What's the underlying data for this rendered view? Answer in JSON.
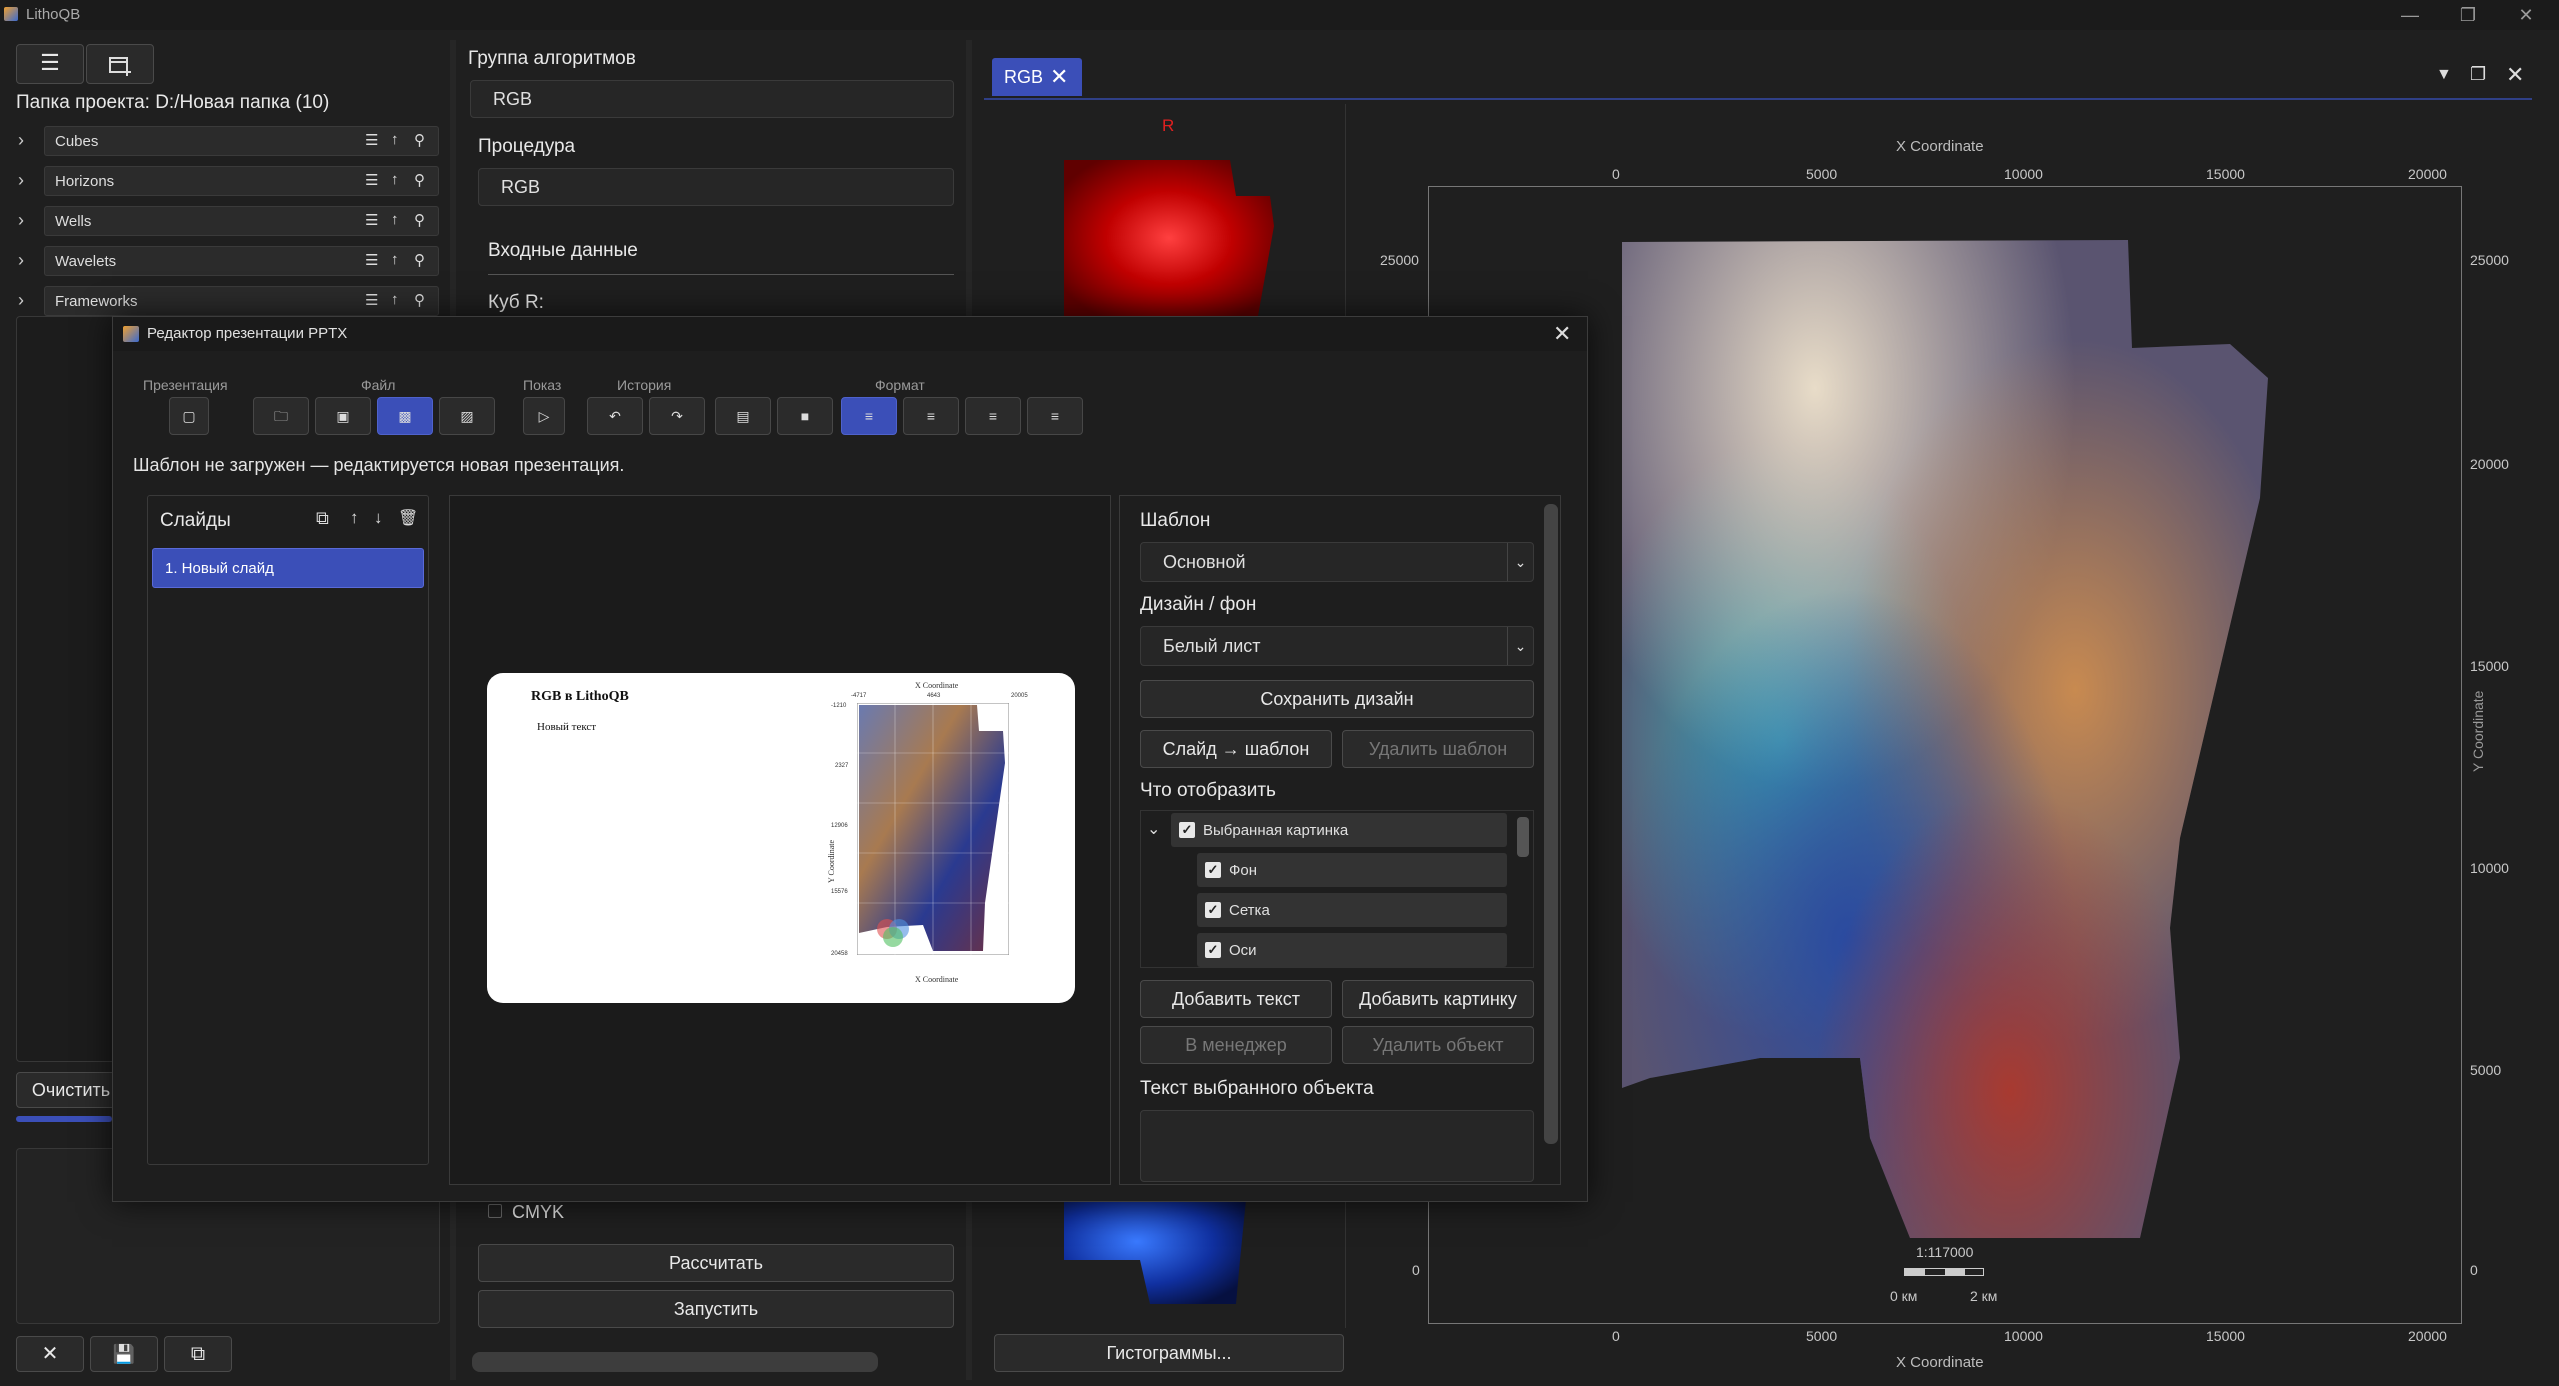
{
  "app": {
    "title": "LithoQB"
  },
  "left": {
    "project_folder": "Папка проекта: D:/Новая папка (10)",
    "tree": [
      {
        "label": "Cubes"
      },
      {
        "label": "Horizons"
      },
      {
        "label": "Wells"
      },
      {
        "label": "Wavelets"
      },
      {
        "label": "Frameworks"
      }
    ],
    "clear_button": "Очистить"
  },
  "middle": {
    "algorithm_group_label": "Группа алгоритмов",
    "algorithm_group_value": "RGB",
    "procedure_label": "Процедура",
    "procedure_value": "RGB",
    "input_data_label": "Входные данные",
    "cube_r_label": "Куб R:",
    "cmyk_label": "CMYK",
    "calculate_button": "Рассчитать",
    "run_button": "Запустить"
  },
  "viewer": {
    "tab_label": "RGB",
    "r_channel_label": "R",
    "histograms_button": "Гистограммы...",
    "x_axis_title": "X Coordinate",
    "y_axis_title": "Y Coordinate",
    "x_ticks": [
      "0",
      "5000",
      "10000",
      "15000",
      "20000"
    ],
    "y_ticks": [
      "25000",
      "20000",
      "15000",
      "10000",
      "5000",
      "0"
    ],
    "scale_text": "1:117000",
    "scale_left": "0 км",
    "scale_right": "2 км"
  },
  "dialog": {
    "title": "Редактор презентации PPTX",
    "groups": {
      "presentation": "Презентация",
      "file": "Файл",
      "show": "Показ",
      "history": "История",
      "format": "Формат"
    },
    "status": "Шаблон не загружен — редактируется новая презентация.",
    "slides_label": "Слайды",
    "slides": [
      "1. Новый слайд"
    ],
    "preview": {
      "title": "RGB в LithoQB",
      "text": "Новый текст",
      "mini_x_title": "X Coordinate",
      "mini_y_title": "Y Coordinate",
      "mini_ticks_top": [
        "-4717",
        "4643",
        "20005"
      ],
      "mini_ticks_left": [
        "-1210",
        "2327",
        "12906",
        "15576",
        "20458"
      ]
    },
    "right": {
      "template_label": "Шаблон",
      "template_value": "Основной",
      "design_label": "Дизайн / фон",
      "design_value": "Белый лист",
      "save_design_button": "Сохранить дизайн",
      "slide_to_template_button": "Слайд → шаблон",
      "delete_template_button": "Удалить шаблон",
      "show_label": "Что отобразить",
      "show_items": [
        {
          "label": "Выбранная картинка",
          "checked": true
        },
        {
          "label": "Фон",
          "checked": true
        },
        {
          "label": "Сетка",
          "checked": true
        },
        {
          "label": "Оси",
          "checked": true
        }
      ],
      "add_text_button": "Добавить текст",
      "add_image_button": "Добавить картинку",
      "to_manager_button": "В менеджер",
      "delete_object_button": "Удалить объект",
      "selected_text_label": "Текст выбранного объекта"
    }
  }
}
